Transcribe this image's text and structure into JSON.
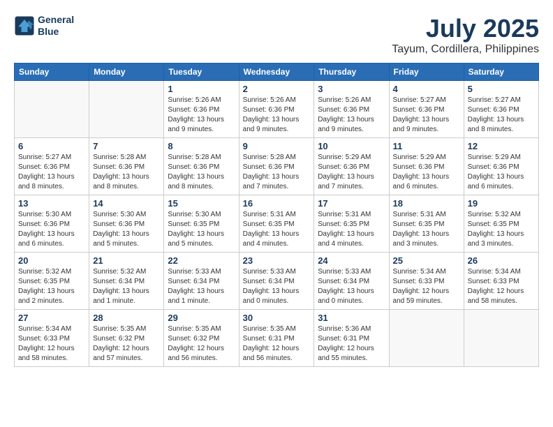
{
  "header": {
    "logo_line1": "General",
    "logo_line2": "Blue",
    "month": "July 2025",
    "location": "Tayum, Cordillera, Philippines"
  },
  "weekdays": [
    "Sunday",
    "Monday",
    "Tuesday",
    "Wednesday",
    "Thursday",
    "Friday",
    "Saturday"
  ],
  "weeks": [
    [
      {
        "day": "",
        "info": ""
      },
      {
        "day": "",
        "info": ""
      },
      {
        "day": "1",
        "info": "Sunrise: 5:26 AM\nSunset: 6:36 PM\nDaylight: 13 hours and 9 minutes."
      },
      {
        "day": "2",
        "info": "Sunrise: 5:26 AM\nSunset: 6:36 PM\nDaylight: 13 hours and 9 minutes."
      },
      {
        "day": "3",
        "info": "Sunrise: 5:26 AM\nSunset: 6:36 PM\nDaylight: 13 hours and 9 minutes."
      },
      {
        "day": "4",
        "info": "Sunrise: 5:27 AM\nSunset: 6:36 PM\nDaylight: 13 hours and 9 minutes."
      },
      {
        "day": "5",
        "info": "Sunrise: 5:27 AM\nSunset: 6:36 PM\nDaylight: 13 hours and 8 minutes."
      }
    ],
    [
      {
        "day": "6",
        "info": "Sunrise: 5:27 AM\nSunset: 6:36 PM\nDaylight: 13 hours and 8 minutes."
      },
      {
        "day": "7",
        "info": "Sunrise: 5:28 AM\nSunset: 6:36 PM\nDaylight: 13 hours and 8 minutes."
      },
      {
        "day": "8",
        "info": "Sunrise: 5:28 AM\nSunset: 6:36 PM\nDaylight: 13 hours and 8 minutes."
      },
      {
        "day": "9",
        "info": "Sunrise: 5:28 AM\nSunset: 6:36 PM\nDaylight: 13 hours and 7 minutes."
      },
      {
        "day": "10",
        "info": "Sunrise: 5:29 AM\nSunset: 6:36 PM\nDaylight: 13 hours and 7 minutes."
      },
      {
        "day": "11",
        "info": "Sunrise: 5:29 AM\nSunset: 6:36 PM\nDaylight: 13 hours and 6 minutes."
      },
      {
        "day": "12",
        "info": "Sunrise: 5:29 AM\nSunset: 6:36 PM\nDaylight: 13 hours and 6 minutes."
      }
    ],
    [
      {
        "day": "13",
        "info": "Sunrise: 5:30 AM\nSunset: 6:36 PM\nDaylight: 13 hours and 6 minutes."
      },
      {
        "day": "14",
        "info": "Sunrise: 5:30 AM\nSunset: 6:36 PM\nDaylight: 13 hours and 5 minutes."
      },
      {
        "day": "15",
        "info": "Sunrise: 5:30 AM\nSunset: 6:35 PM\nDaylight: 13 hours and 5 minutes."
      },
      {
        "day": "16",
        "info": "Sunrise: 5:31 AM\nSunset: 6:35 PM\nDaylight: 13 hours and 4 minutes."
      },
      {
        "day": "17",
        "info": "Sunrise: 5:31 AM\nSunset: 6:35 PM\nDaylight: 13 hours and 4 minutes."
      },
      {
        "day": "18",
        "info": "Sunrise: 5:31 AM\nSunset: 6:35 PM\nDaylight: 13 hours and 3 minutes."
      },
      {
        "day": "19",
        "info": "Sunrise: 5:32 AM\nSunset: 6:35 PM\nDaylight: 13 hours and 3 minutes."
      }
    ],
    [
      {
        "day": "20",
        "info": "Sunrise: 5:32 AM\nSunset: 6:35 PM\nDaylight: 13 hours and 2 minutes."
      },
      {
        "day": "21",
        "info": "Sunrise: 5:32 AM\nSunset: 6:34 PM\nDaylight: 13 hours and 1 minute."
      },
      {
        "day": "22",
        "info": "Sunrise: 5:33 AM\nSunset: 6:34 PM\nDaylight: 13 hours and 1 minute."
      },
      {
        "day": "23",
        "info": "Sunrise: 5:33 AM\nSunset: 6:34 PM\nDaylight: 13 hours and 0 minutes."
      },
      {
        "day": "24",
        "info": "Sunrise: 5:33 AM\nSunset: 6:34 PM\nDaylight: 13 hours and 0 minutes."
      },
      {
        "day": "25",
        "info": "Sunrise: 5:34 AM\nSunset: 6:33 PM\nDaylight: 12 hours and 59 minutes."
      },
      {
        "day": "26",
        "info": "Sunrise: 5:34 AM\nSunset: 6:33 PM\nDaylight: 12 hours and 58 minutes."
      }
    ],
    [
      {
        "day": "27",
        "info": "Sunrise: 5:34 AM\nSunset: 6:33 PM\nDaylight: 12 hours and 58 minutes."
      },
      {
        "day": "28",
        "info": "Sunrise: 5:35 AM\nSunset: 6:32 PM\nDaylight: 12 hours and 57 minutes."
      },
      {
        "day": "29",
        "info": "Sunrise: 5:35 AM\nSunset: 6:32 PM\nDaylight: 12 hours and 56 minutes."
      },
      {
        "day": "30",
        "info": "Sunrise: 5:35 AM\nSunset: 6:31 PM\nDaylight: 12 hours and 56 minutes."
      },
      {
        "day": "31",
        "info": "Sunrise: 5:36 AM\nSunset: 6:31 PM\nDaylight: 12 hours and 55 minutes."
      },
      {
        "day": "",
        "info": ""
      },
      {
        "day": "",
        "info": ""
      }
    ]
  ]
}
